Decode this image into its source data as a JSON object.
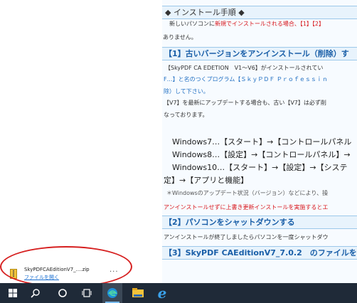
{
  "article": {
    "install_header": "◆ インストール手順 ◆",
    "intro_line1_a": "新しいパソコンに",
    "intro_line1_red": "新規でインストールされる場合",
    "intro_line1_b": "、【1】【2】",
    "intro_line2": "ありません。",
    "step1_title": "【1】古いバージョンをアンインストール（削除）す",
    "step1_line1": "【SkyPDF CA EDETION　V1～V6】がインストールされてい",
    "step1_line2": "F…】と名のつくプログラム【ＳｋｙＰＤＦ Ｐｒｏｆｅｓｓｉｎ",
    "step1_line3": "除）して下さい。",
    "step1_line4": "【V7】を最新にアップデートする場合も、古い【V7】は必ず削",
    "step1_line5": "なっております。",
    "win7": "Windows7…【スタート】→【コントロールパネル",
    "win8": "Windows8…【設定】→【コントロールパネル】→",
    "win10": "Windows10…【スタート】→【設定】→【システ",
    "win10_cont": "定】→【アプリと機能】",
    "note": "＊Windowsのアップデート状況（バージョン）などにより、操",
    "warning": "アンインストールせずに上書き更新インストールを実施するとエ",
    "step2_title": "【2】パソコンをシャットダウンする",
    "step2_line1": "アンインストールが終了しましたらパソコンを一度シャットダウ",
    "step3_title": "【3】SkyPDF CAEditionV7_7.0.2　のファイルを開"
  },
  "download": {
    "filename": "SkyPDFCAEditionV7_....zip",
    "open_link": "ファイルを開く",
    "more": "···"
  },
  "taskbar": {
    "apps": [
      "windows-start",
      "search",
      "cortana",
      "task-view",
      "edge",
      "file-explorer",
      "internet-explorer"
    ]
  },
  "colors": {
    "accent_blue": "#1a6fb3",
    "warning_red": "#d8161b",
    "highlight_circle": "#d61f1f",
    "taskbar_bg": "#1f2a38"
  }
}
